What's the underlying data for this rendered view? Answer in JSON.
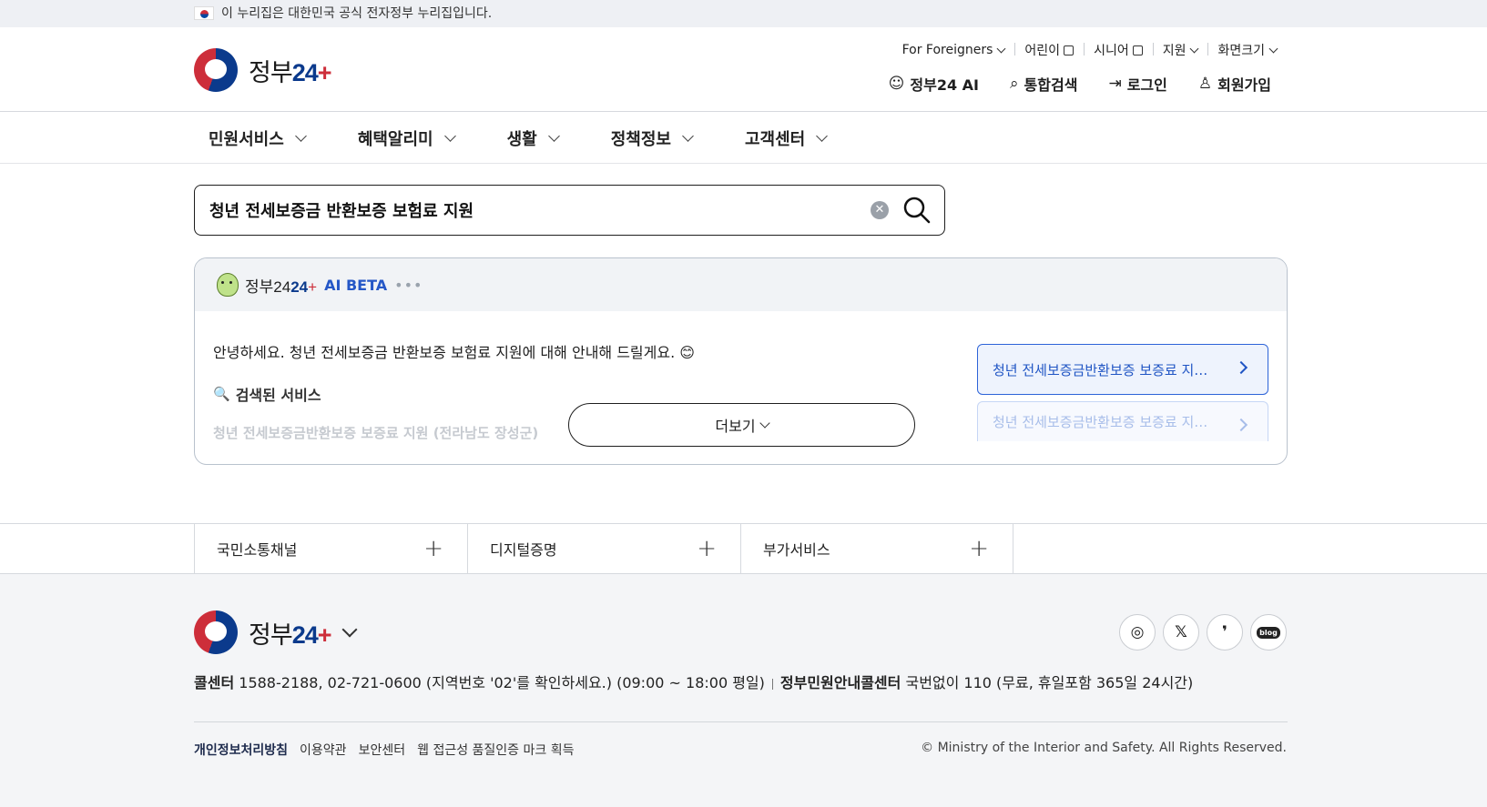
{
  "official_banner": "이 누리집은 대한민국 공식 전자정부 누리집입니다.",
  "logo": {
    "text": "정부",
    "num": "24"
  },
  "utility": [
    {
      "label": "For Foreigners",
      "type": "dropdown"
    },
    {
      "label": "어린이",
      "type": "external"
    },
    {
      "label": "시니어",
      "type": "external"
    },
    {
      "label": "지원",
      "type": "dropdown"
    },
    {
      "label": "화면크기",
      "type": "dropdown"
    }
  ],
  "header_links": {
    "ai": "정부24 AI",
    "search": "통합검색",
    "login": "로그인",
    "signup": "회원가입"
  },
  "nav": [
    "민원서비스",
    "혜택알리미",
    "생활",
    "정책정보",
    "고객센터"
  ],
  "search": {
    "value": "청년 전세보증금 반환보증 보험료 지원"
  },
  "ai_panel": {
    "brand": "정부24",
    "beta": "AI BETA",
    "dots": "•••",
    "message": "안녕하세요. 청년 전세보증금 반환보증 보험료 지원에 대해 안내해 드릴게요. 😊",
    "sub_title": "검색된 서비스",
    "faded_item": "청년 전세보증금반환보증 보증료 지원 (전라남도 장성군)",
    "more_label": "더보기",
    "recommendations": [
      "청년 전세보증금반환보증 보증료 지…",
      "청년 전세보증금반환보증 보증료 지…"
    ]
  },
  "quick_links": [
    "국민소통채널",
    "디지털증명",
    "부가서비스"
  ],
  "footer": {
    "call_label": "콜센터",
    "call_text": "1588-2188, 02-721-0600 (지역번호 '02'를 확인하세요.) (09:00 ~ 18:00 평일)",
    "gov_call_label": "정부민원안내콜센터",
    "gov_call_text": "국번없이 110 (무료, 휴일포함 365일 24시간)",
    "policies": [
      "개인정보처리방침",
      "이용약관",
      "보안센터",
      "웹 접근성 품질인증 마크 획득"
    ],
    "copyright": "© Ministry of the Interior and Safety. All Rights Reserved."
  },
  "colors": {
    "primary": "#0b3a8c",
    "accent": "#cd2e3a",
    "link_blue": "#2557c7"
  }
}
